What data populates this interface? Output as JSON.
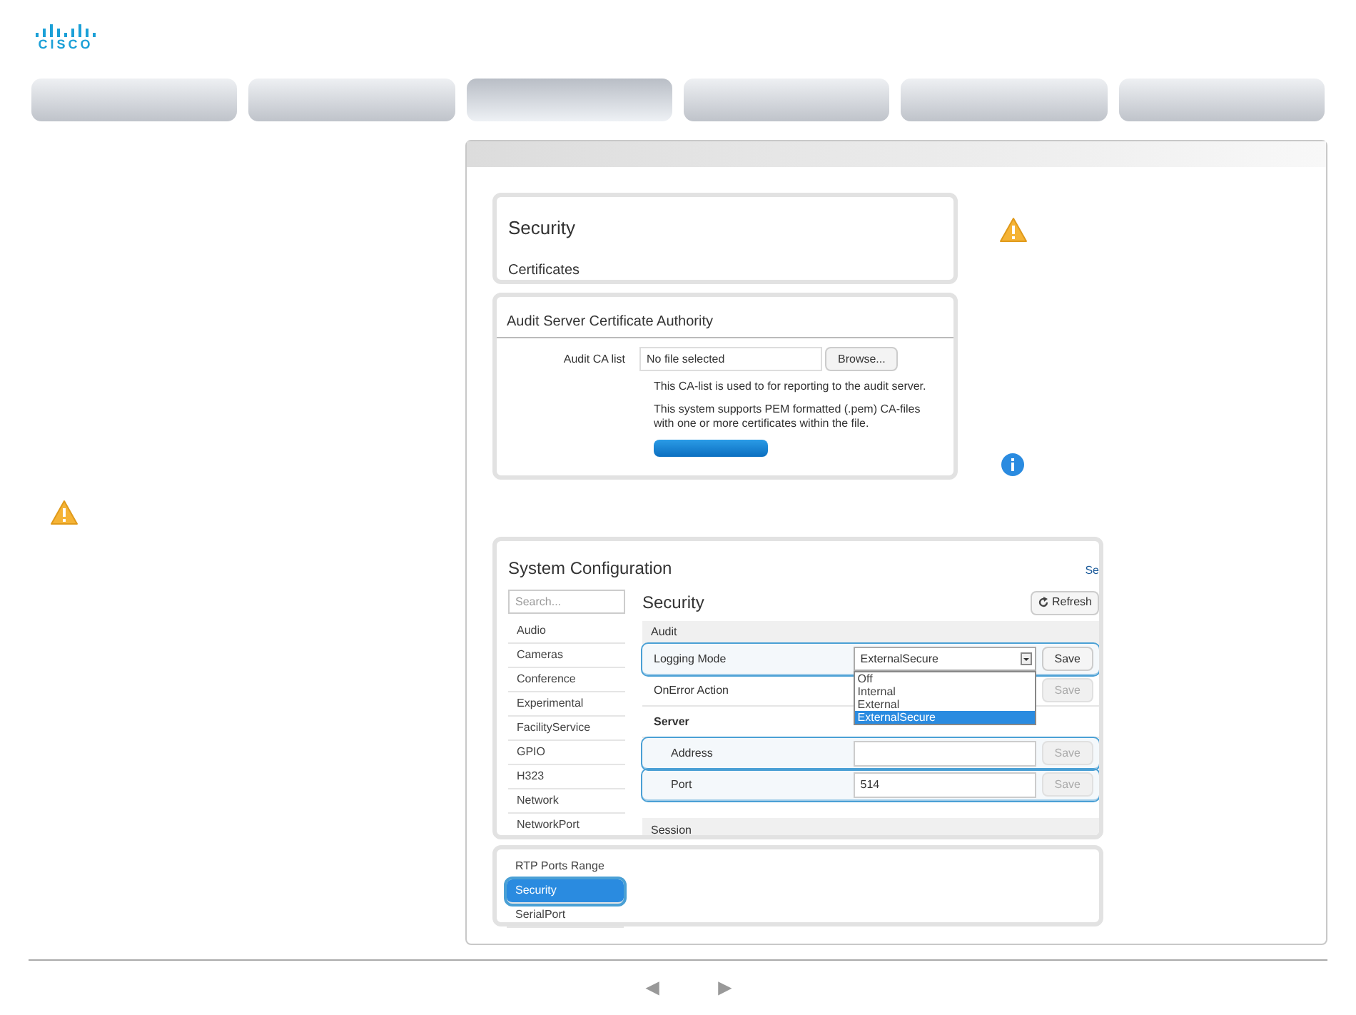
{
  "logo": {
    "text": "CISCO"
  },
  "tabs": [
    {
      "selected": false
    },
    {
      "selected": false
    },
    {
      "selected": true
    },
    {
      "selected": false
    },
    {
      "selected": false
    },
    {
      "selected": false
    }
  ],
  "certificates_panel": {
    "title": "Security",
    "subtitle": "Certificates"
  },
  "audit_ca": {
    "heading": "Audit Server Certificate Authority",
    "label": "Audit CA list",
    "file_value": "No file selected",
    "browse_button": "Browse...",
    "note_1": "This CA-list is used to for reporting to the audit server.",
    "note_2": "This system supports PEM formatted (.pem) CA-files with one or more certificates within the file."
  },
  "config": {
    "title": "System Configuration",
    "cut_link": "Se",
    "search": {
      "placeholder": "Search..."
    },
    "categories_top": [
      {
        "label": "Audio",
        "selected": false
      },
      {
        "label": "Cameras",
        "selected": false
      },
      {
        "label": "Conference",
        "selected": false
      },
      {
        "label": "Experimental",
        "selected": false
      },
      {
        "label": "FacilityService",
        "selected": false
      },
      {
        "label": "GPIO",
        "selected": false
      },
      {
        "label": "H323",
        "selected": false
      },
      {
        "label": "Network",
        "selected": false
      },
      {
        "label": "NetworkPort",
        "selected": false
      }
    ],
    "categories_bottom": [
      {
        "label": "RTP Ports Range",
        "selected": false
      },
      {
        "label": "Security",
        "selected": true
      },
      {
        "label": "SerialPort",
        "selected": false
      }
    ],
    "section_title": "Security",
    "refresh_button": "Refresh",
    "group_title": "Audit",
    "rows": [
      {
        "kind": "select",
        "label": "Logging Mode",
        "value": "ExternalSecure",
        "save": "Save",
        "save_disabled": false,
        "highlighted": true,
        "open": true,
        "options": [
          {
            "label": "Off",
            "selected": false
          },
          {
            "label": "Internal",
            "selected": false
          },
          {
            "label": "External",
            "selected": false
          },
          {
            "label": "ExternalSecure",
            "selected": true
          }
        ]
      },
      {
        "kind": "setting",
        "label": "OnError Action",
        "save": "Save",
        "save_disabled": true,
        "highlighted": false
      },
      {
        "kind": "subheading",
        "label": "Server"
      },
      {
        "kind": "input",
        "label": "Address",
        "save": "Save",
        "save_disabled": true,
        "highlighted": true
      },
      {
        "kind": "input",
        "label": "Port",
        "value": "514",
        "save": "Save",
        "save_disabled": true,
        "highlighted": true
      }
    ],
    "next_group_title": "Session"
  },
  "pager": {
    "previous": "◄",
    "next": "►"
  }
}
